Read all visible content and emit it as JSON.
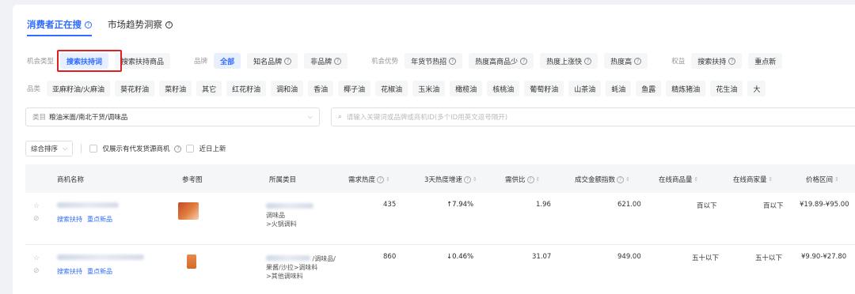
{
  "tabs": [
    {
      "label": "消费者正在搜"
    },
    {
      "label": "市场趋势洞察"
    }
  ],
  "filters": {
    "opp_type_label": "机会类型",
    "opp_types": [
      "搜索扶持词",
      "搜索扶持商品"
    ],
    "brand_label": "品牌",
    "brands": [
      "全部",
      "知名品牌",
      "非品牌"
    ],
    "advantage_label": "机会优势",
    "advantages": [
      "年货节热招",
      "热度高商品少",
      "热度上涨快",
      "热度高"
    ],
    "benefit_label": "权益",
    "benefits": [
      "搜索扶持",
      "重点新"
    ],
    "category_label": "品类",
    "categories": [
      "亚麻籽油/火麻油",
      "葵花籽油",
      "菜籽油",
      "其它",
      "红花籽油",
      "调和油",
      "香油",
      "椰子油",
      "花椒油",
      "玉米油",
      "橄榄油",
      "核桃油",
      "葡萄籽油",
      "山茶油",
      "蚝油",
      "鱼露",
      "精炼猪油",
      "花生油",
      "大"
    ]
  },
  "category_select": {
    "key": "类目",
    "value": "粮油米面/南北干货/调味品"
  },
  "search": {
    "placeholder": "请输入关键词或品牌或商机ID(多个ID用英文逗号隔开)"
  },
  "sort": {
    "label": "综合排序",
    "option1": "仅展示有代发货源商机",
    "option2": "近日上新"
  },
  "table": {
    "headers": [
      "商机名称",
      "参考图",
      "所属类目",
      "需求热度",
      "3天热度增速",
      "需供比",
      "成交金额指数",
      "在线商品量",
      "在线商家量",
      "价格区间"
    ],
    "rows": [
      {
        "tags": [
          "搜索扶持",
          "重点新品"
        ],
        "category_lines": [
          "调味品",
          ">火锅调料"
        ],
        "heat": "435",
        "growth": "↑7.94%",
        "ratio": "1.96",
        "gmv": "621.00",
        "items": "百以下",
        "sellers": "百以下",
        "price": "¥19.89-¥95.00"
      },
      {
        "tags": [
          "搜索扶持",
          "重点新品"
        ],
        "category_lines": [
          "/调味品/",
          "果酱/沙拉>调味料",
          ">其他调味料"
        ],
        "heat": "860",
        "growth": "↓0.46%",
        "ratio": "31.07",
        "gmv": "949.00",
        "items": "五十以下",
        "sellers": "五十以下",
        "price": "¥9.90-¥27.80"
      }
    ]
  },
  "colors": {
    "accent": "#2f6bff",
    "highlight_box": "#e02020"
  }
}
